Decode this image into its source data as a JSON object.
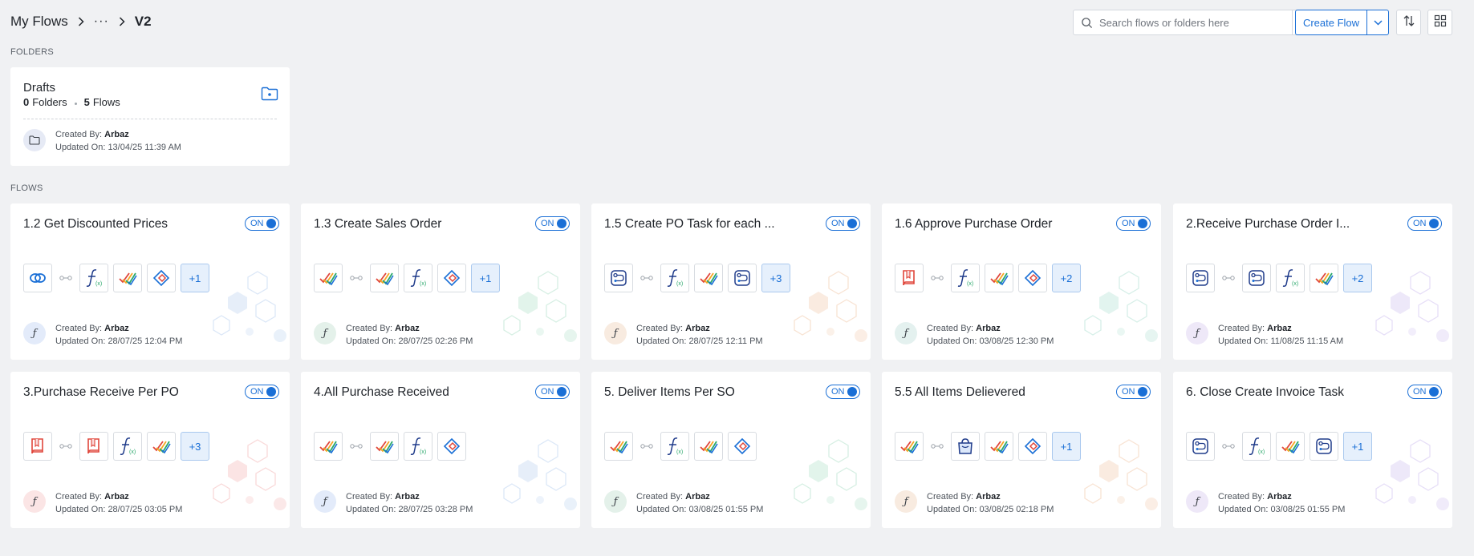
{
  "breadcrumb": {
    "root": "My Flows",
    "ellipsis": "···",
    "current": "V2"
  },
  "search": {
    "placeholder": "Search flows or folders here",
    "value": ""
  },
  "toolbar": {
    "create_label": "Create Flow"
  },
  "sections": {
    "folders": "FOLDERS",
    "flows": "FLOWS"
  },
  "folder": {
    "name": "Drafts",
    "folders_count": "0",
    "folders_label": "Folders",
    "flows_count": "5",
    "flows_label": "Flows",
    "created_label": "Created By:",
    "created_by": "Arbaz",
    "updated_label": "Updated On:",
    "updated_on": "13/04/25 11:39 AM"
  },
  "labels": {
    "created": "Created By:",
    "updated": "Updated On:",
    "toggle_on": "ON"
  },
  "colors": {
    "accent": "#1a6fd6",
    "background": "#f0f1f3",
    "card": "#ffffff"
  },
  "flows": [
    {
      "title": "1.2 Get Discounted Prices",
      "steps": [
        "link-icon",
        "function-icon",
        "checklist-icon",
        "diamond-task-icon"
      ],
      "more": "+1",
      "created_by": "Arbaz",
      "updated_on": "28/07/25 12:04 PM",
      "avatar_bg": "#e3ebfa",
      "deco": "#dbe7f7"
    },
    {
      "title": "1.3 Create Sales Order",
      "steps": [
        "checklist-icon",
        "checklist-icon",
        "function-icon",
        "diamond-task-icon"
      ],
      "more": "+1",
      "created_by": "Arbaz",
      "updated_on": "28/07/25 02:26 PM",
      "avatar_bg": "#e4f1ea",
      "deco": "#d6efe3"
    },
    {
      "title": "1.5 Create PO Task for each ...",
      "steps": [
        "route-icon",
        "function-icon",
        "checklist-icon",
        "route-icon"
      ],
      "more": "+3",
      "created_by": "Arbaz",
      "updated_on": "28/07/25 12:11 PM",
      "avatar_bg": "#f8ebe0",
      "deco": "#f8e3d3"
    },
    {
      "title": "1.6 Approve Purchase Order",
      "steps": [
        "book-icon",
        "function-icon",
        "checklist-icon",
        "diamond-task-icon"
      ],
      "more": "+2",
      "created_by": "Arbaz",
      "updated_on": "03/08/25 12:30 PM",
      "avatar_bg": "#e4f1ef",
      "deco": "#d6efe8"
    },
    {
      "title": "2.Receive Purchase Order I...",
      "steps": [
        "route-icon",
        "route-icon",
        "function-icon",
        "checklist-icon"
      ],
      "more": "+2",
      "created_by": "Arbaz",
      "updated_on": "11/08/25 11:15 AM",
      "avatar_bg": "#eee8f8",
      "deco": "#e6def7"
    },
    {
      "title": "3.Purchase Receive Per PO",
      "steps": [
        "book-icon",
        "book-icon",
        "function-icon",
        "checklist-icon"
      ],
      "more": "+3",
      "created_by": "Arbaz",
      "updated_on": "28/07/25 03:05 PM",
      "avatar_bg": "#fbe5e5",
      "deco": "#f9d9d9"
    },
    {
      "title": "4.All Purchase Received",
      "steps": [
        "checklist-icon",
        "checklist-icon",
        "function-icon",
        "diamond-task-icon"
      ],
      "more": "",
      "created_by": "Arbaz",
      "updated_on": "28/07/25 03:28 PM",
      "avatar_bg": "#e3ebfa",
      "deco": "#dbe7f7"
    },
    {
      "title": "5. Deliver Items Per SO",
      "steps": [
        "checklist-icon",
        "function-icon",
        "checklist-icon",
        "diamond-task-icon"
      ],
      "more": "",
      "created_by": "Arbaz",
      "updated_on": "03/08/25 01:55 PM",
      "avatar_bg": "#e4f1ea",
      "deco": "#d6efe3"
    },
    {
      "title": "5.5 All Items Delievered",
      "steps": [
        "checklist-icon",
        "bag-icon",
        "checklist-icon",
        "diamond-task-icon"
      ],
      "more": "+1",
      "created_by": "Arbaz",
      "updated_on": "03/08/25 02:18 PM",
      "avatar_bg": "#f8ebe0",
      "deco": "#f8e3d3"
    },
    {
      "title": "6. Close Create Invoice Task",
      "steps": [
        "route-icon",
        "function-icon",
        "checklist-icon",
        "route-icon"
      ],
      "more": "+1",
      "created_by": "Arbaz",
      "updated_on": "03/08/25 01:55 PM",
      "avatar_bg": "#eee8f8",
      "deco": "#e6def7"
    }
  ]
}
